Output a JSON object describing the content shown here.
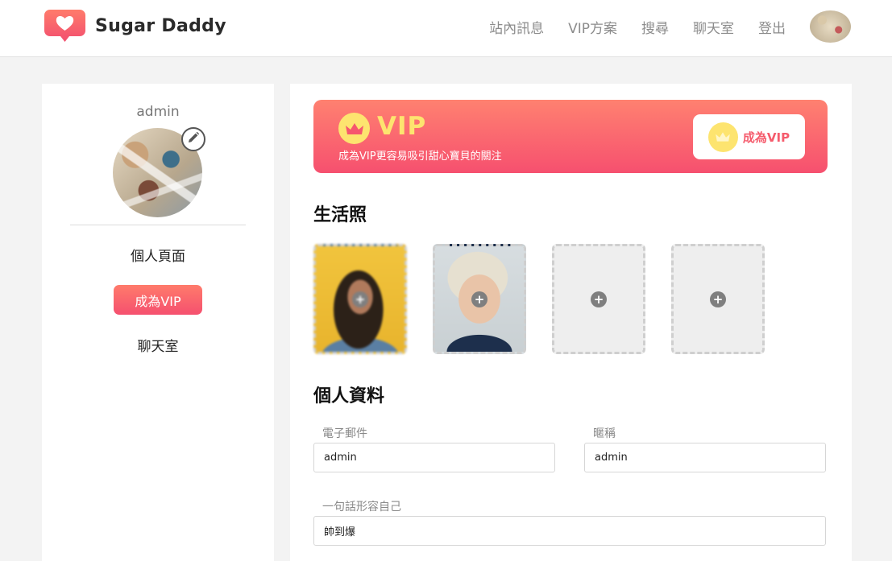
{
  "brand": {
    "name": "Sugar Daddy",
    "icon": "heart-chat-icon",
    "color": "#f6556e"
  },
  "nav": {
    "items": [
      "站內訊息",
      "VIP方案",
      "搜尋",
      "聊天室",
      "登出"
    ],
    "avatar_icon": "user-avatar"
  },
  "sidebar": {
    "username": "admin",
    "edit_icon": "pencil-icon",
    "links": {
      "profile": "個人頁面",
      "vip": "成為VIP",
      "chat": "聊天室"
    }
  },
  "vip_banner": {
    "title": "VIP",
    "subtitle": "成為VIP更容易吸引甜心寶貝的關注",
    "cta_label": "成為VIP",
    "crown_icon": "crown-icon",
    "colors": {
      "gradient_top": "#ff8170",
      "gradient_bottom": "#f6506f",
      "gold": "#fde46f"
    }
  },
  "photos": {
    "title": "生活照",
    "slots": [
      {
        "filled": true,
        "add_icon": "plus-icon"
      },
      {
        "filled": true,
        "add_icon": "plus-icon"
      },
      {
        "filled": false,
        "add_icon": "plus-icon"
      },
      {
        "filled": false,
        "add_icon": "plus-icon"
      }
    ]
  },
  "profile": {
    "title": "個人資料",
    "email": {
      "label": "電子郵件",
      "value": "admin"
    },
    "nickname": {
      "label": "暱稱",
      "value": "admin"
    },
    "bio": {
      "label": "一句話形容自己",
      "value": "帥到爆"
    }
  }
}
